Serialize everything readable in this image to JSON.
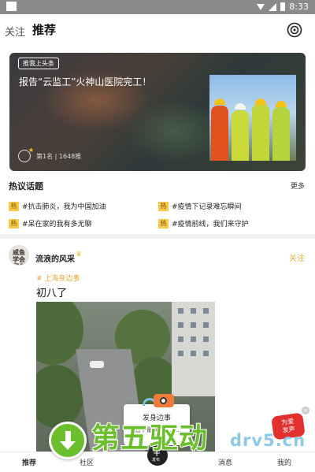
{
  "status_bar": {
    "time": "8:33"
  },
  "top_nav": {
    "follow_tab": "关注",
    "recommend_tab": "推荐"
  },
  "banner": {
    "tag": "推我上头条",
    "title": "报告“云监工”火神山医院完工！",
    "rank_info": "第1名 | 1648推"
  },
  "hot_topics": {
    "title": "热议话题",
    "more": "更多",
    "badge": "热",
    "items": [
      "#抗击肺炎，我为中国加油",
      "#疫情下记录难忘瞬间",
      "#呆在家的我有多无聊",
      "#疫情前线，我们来守护"
    ]
  },
  "post": {
    "avatar_text": "咸鱼 学会翻身 藏子",
    "username": "流浪的风采",
    "verify_icon": "♛",
    "follow": "关注",
    "tag": "# 上海身边事",
    "text": "初八了"
  },
  "popup": {
    "title": "发身边事",
    "subtitle": "拍下最美瞬...  ..."
  },
  "float_badge": {
    "text": "为爱\n发声"
  },
  "tab_bar": {
    "home": "推荐",
    "community": "社区",
    "publish": "发布",
    "messages": "消息",
    "mine": "我的"
  },
  "watermark": {
    "text": "第五驱动",
    "domain": "drv5.cn"
  },
  "colors": {
    "accent": "#e8b24a",
    "hot_badge": "#f6c94a",
    "watermark_green": "#6bbf2c"
  }
}
